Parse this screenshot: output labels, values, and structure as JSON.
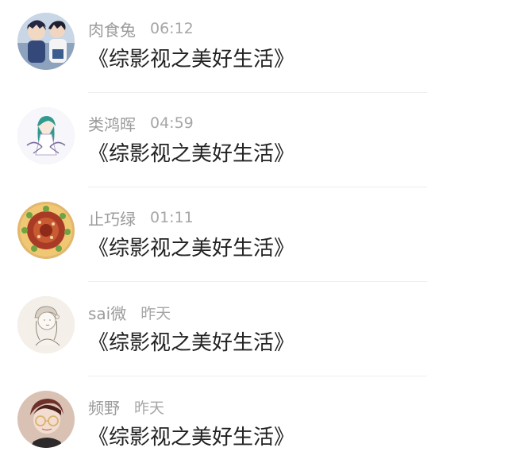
{
  "comments": [
    {
      "username": "肉食兔",
      "time": "06:12",
      "text": "《综影视之美好生活》",
      "avatar_icon": "anime-boys-avatar-icon"
    },
    {
      "username": "类鸿晖",
      "time": "04:59",
      "text": "《综影视之美好生活》",
      "avatar_icon": "anime-girl-sketch-avatar-icon"
    },
    {
      "username": "止巧绿",
      "time": "01:11",
      "text": "《综影视之美好生活》",
      "avatar_icon": "pizza-flower-avatar-icon"
    },
    {
      "username": "sai微",
      "time": "昨天",
      "text": "《综影视之美好生活》",
      "avatar_icon": "pencil-sketch-girl-avatar-icon"
    },
    {
      "username": "频野",
      "time": "昨天",
      "text": "《综影视之美好生活》",
      "avatar_icon": "boy-with-glasses-avatar-icon"
    }
  ],
  "colors": {
    "username": "#9b9b9b",
    "timestamp": "#a6a6a6",
    "comment_text": "#222222",
    "divider": "#eeeeee",
    "background": "#ffffff"
  }
}
